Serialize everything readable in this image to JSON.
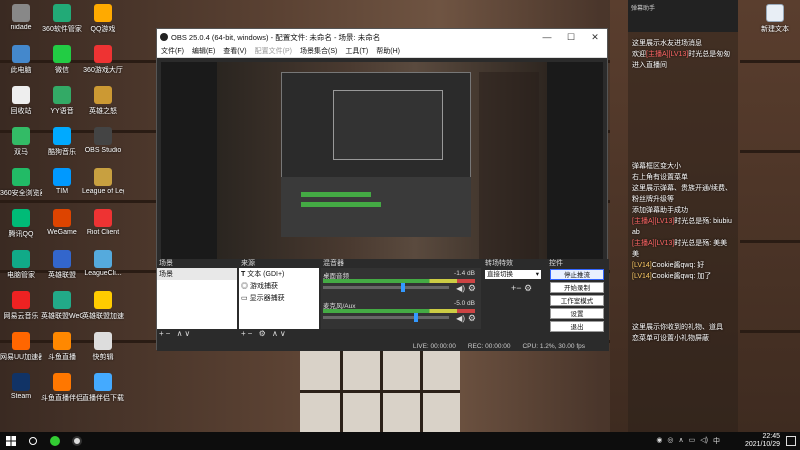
{
  "desktop": {
    "icons": [
      {
        "label": "nidade"
      },
      {
        "label": "360软件管家"
      },
      {
        "label": "QQ游戏"
      },
      {
        "label": "此电脑"
      },
      {
        "label": "微信"
      },
      {
        "label": "360游戏大厅"
      },
      {
        "label": "回收站"
      },
      {
        "label": "YY语音"
      },
      {
        "label": "英雄之怒"
      },
      {
        "label": "双马"
      },
      {
        "label": "酷狗音乐"
      },
      {
        "label": "OBS Studio"
      },
      {
        "label": "360安全浏览器"
      },
      {
        "label": "TIM"
      },
      {
        "label": "League of Legend..."
      },
      {
        "label": "腾讯QQ"
      },
      {
        "label": "WeGame"
      },
      {
        "label": "Riot Client"
      },
      {
        "label": "电脑管家"
      },
      {
        "label": "英雄联盟"
      },
      {
        "label": "LeagueCli..."
      },
      {
        "label": "网易云音乐"
      },
      {
        "label": "英雄联盟WeGame版"
      },
      {
        "label": "英雄联盟加速器"
      },
      {
        "label": "网易UU加速器"
      },
      {
        "label": "斗鱼直播"
      },
      {
        "label": "快剪辑"
      },
      {
        "label": "Steam"
      },
      {
        "label": "斗鱼直播伴侣"
      },
      {
        "label": "直播伴侣下载器(1)"
      }
    ],
    "right_icon_label": "新建文本"
  },
  "obs": {
    "title": "OBS 25.0.4 (64-bit, windows) - 配置文件: 未命名 - 场景: 未命名",
    "menu": [
      "文件(F)",
      "编辑(E)",
      "查看(V)",
      "配置文件(P)",
      "场景集合(S)",
      "工具(T)",
      "帮助(H)"
    ],
    "docks": {
      "scenes": {
        "title": "场景",
        "items": [
          "场景"
        ]
      },
      "sources": {
        "title": "来源",
        "items": [
          "文本 (GDI+)",
          "游戏捕获",
          "显示器捕获"
        ]
      },
      "mixer": {
        "title": "混音器",
        "channels": [
          {
            "name": "桌面音频",
            "db": "-1.4 dB",
            "level": 0.62
          },
          {
            "name": "麦克风/Aux",
            "db": "-5.0 dB",
            "level": 0.72
          }
        ]
      },
      "transitions": {
        "title": "转场特效",
        "selected": "直接切换"
      },
      "controls": {
        "title": "控件",
        "buttons": [
          "停止推流",
          "开始录制",
          "工作室模式",
          "设置",
          "退出"
        ]
      }
    },
    "status": {
      "live": "LIVE: 00:00:00",
      "rec": "REC: 00:00:00",
      "cpu": "CPU: 1.2%, 30.00 fps"
    }
  },
  "chat": {
    "header": "弹幕助手",
    "lines": [
      {
        "text": "这里展示水友进场消息"
      },
      {
        "prefix": "欢迎",
        "name": "[主播A][LV13]",
        "text": "时光总是匆匆进入直播间"
      },
      {
        "text": "弹幕框区变大小"
      },
      {
        "text": "右上角有设置菜单"
      },
      {
        "text": "这里展示弹幕、贵族开通/续费、粉丝牌升级等"
      },
      {
        "text": "添加弹幕助手成功"
      },
      {
        "name": "[主播A][LV13]",
        "text": "时光总是殇: biubiu ab"
      },
      {
        "name": "[主播A][LV13]",
        "text": "时光总是殇: 美美美"
      },
      {
        "name": "[LV14]",
        "text": "Cookie酱qwq: 好"
      },
      {
        "name": "[LV14]",
        "text": "Cookie酱qwq: 加了"
      },
      {
        "text": "这里展示你收到的礼物、道具"
      },
      {
        "text": "恋菜单可设置小礼物屏蔽"
      }
    ]
  },
  "taskbar": {
    "time": "22:45",
    "date": "2021/10/29",
    "lang": "中"
  }
}
